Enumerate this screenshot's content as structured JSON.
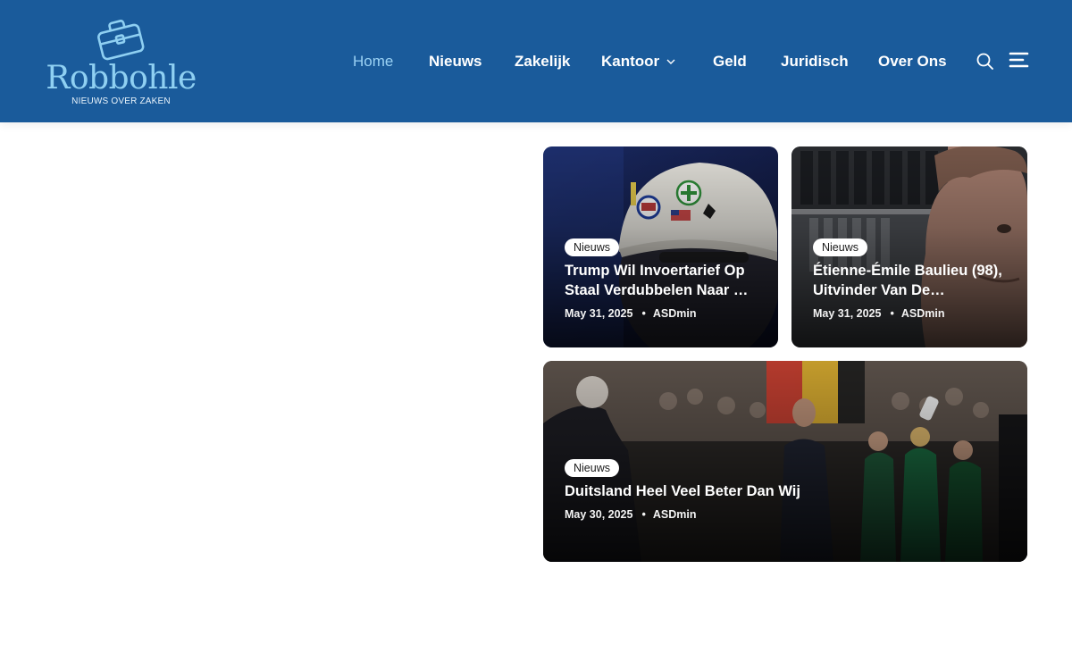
{
  "header": {
    "logo": {
      "name": "Robbohle",
      "tagline": "NIEUWS OVER ZAKEN",
      "icon": "briefcase-icon"
    },
    "nav": [
      {
        "label": "Home",
        "active": true
      },
      {
        "label": "Nieuws",
        "active": false
      },
      {
        "label": "Zakelijk",
        "active": false
      },
      {
        "label": "Kantoor",
        "active": false,
        "has_dropdown": true
      },
      {
        "label": "Geld",
        "active": false
      },
      {
        "label": "Juridisch",
        "active": false
      },
      {
        "label": "Over Ons",
        "active": false
      }
    ],
    "search_icon": "search-icon",
    "menu_icon": "menu-icon"
  },
  "articles": [
    {
      "category": "Nieuws",
      "title_line1": "Trump Wil Invoertarief Op",
      "title_line2": "Staal Verdubbelen Naar …",
      "date": "May 31, 2025",
      "author": "ASDmin"
    },
    {
      "category": "Nieuws",
      "title_line1": "Étienne-Émile Baulieu (98),",
      "title_line2": "Uitvinder Van De…",
      "date": "May 31, 2025",
      "author": "ASDmin"
    },
    {
      "category": "Nieuws",
      "title_line1": "Duitsland Heel Veel Beter Dan Wij",
      "date": "May 30, 2025",
      "author": "ASDmin"
    }
  ],
  "colors": {
    "header_bg": "#1a5b9b",
    "nav_active": "#9bd2f4",
    "logo_text": "#8fd0f2"
  }
}
